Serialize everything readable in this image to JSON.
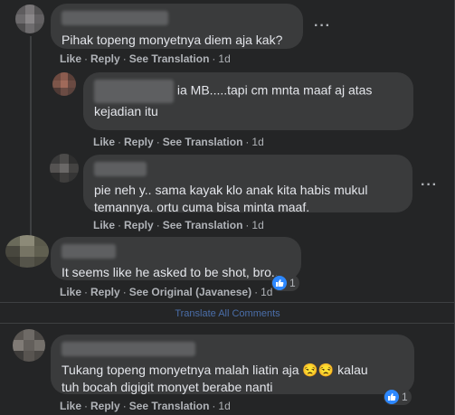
{
  "comments": [
    {
      "text": "Pihak topeng monyetnya diem aja kak?",
      "actions": {
        "like": "Like",
        "reply": "Reply",
        "translation": "See Translation",
        "time": "1d"
      }
    },
    {
      "text_line1": "ia MB.....tapi cm mnta maaf aj atas",
      "text_line2": "kejadian itu",
      "actions": {
        "like": "Like",
        "reply": "Reply",
        "translation": "See Translation",
        "time": "1d"
      }
    },
    {
      "text_line1": "pie neh y.. sama kayak klo anak kita habis mukul",
      "text_line2": "temannya. ortu cuma bisa minta maaf.",
      "actions": {
        "like": "Like",
        "reply": "Reply",
        "translation": "See Translation",
        "time": "1d"
      }
    },
    {
      "text": "It seems like he asked to be shot, bro...",
      "actions": {
        "like": "Like",
        "reply": "Reply",
        "translation": "See Original (Javanese)",
        "time": "1d"
      },
      "reaction_count": "1"
    },
    {
      "text_line1": "Tukang topeng monyetnya malah liatin aja 😒😒 kalau",
      "text_line2": "tuh bocah digigit monyet berabe nanti",
      "actions": {
        "like": "Like",
        "reply": "Reply",
        "translation": "See Translation",
        "time": "1d"
      },
      "reaction_count": "1"
    }
  ],
  "translate_all": "Translate All Comments",
  "more_label": "···",
  "separator": "·",
  "colors": {
    "bubble": "#3a3b3c",
    "link": "#4a6ea9",
    "like_blue": "#2d88ff",
    "background": "#242526"
  }
}
